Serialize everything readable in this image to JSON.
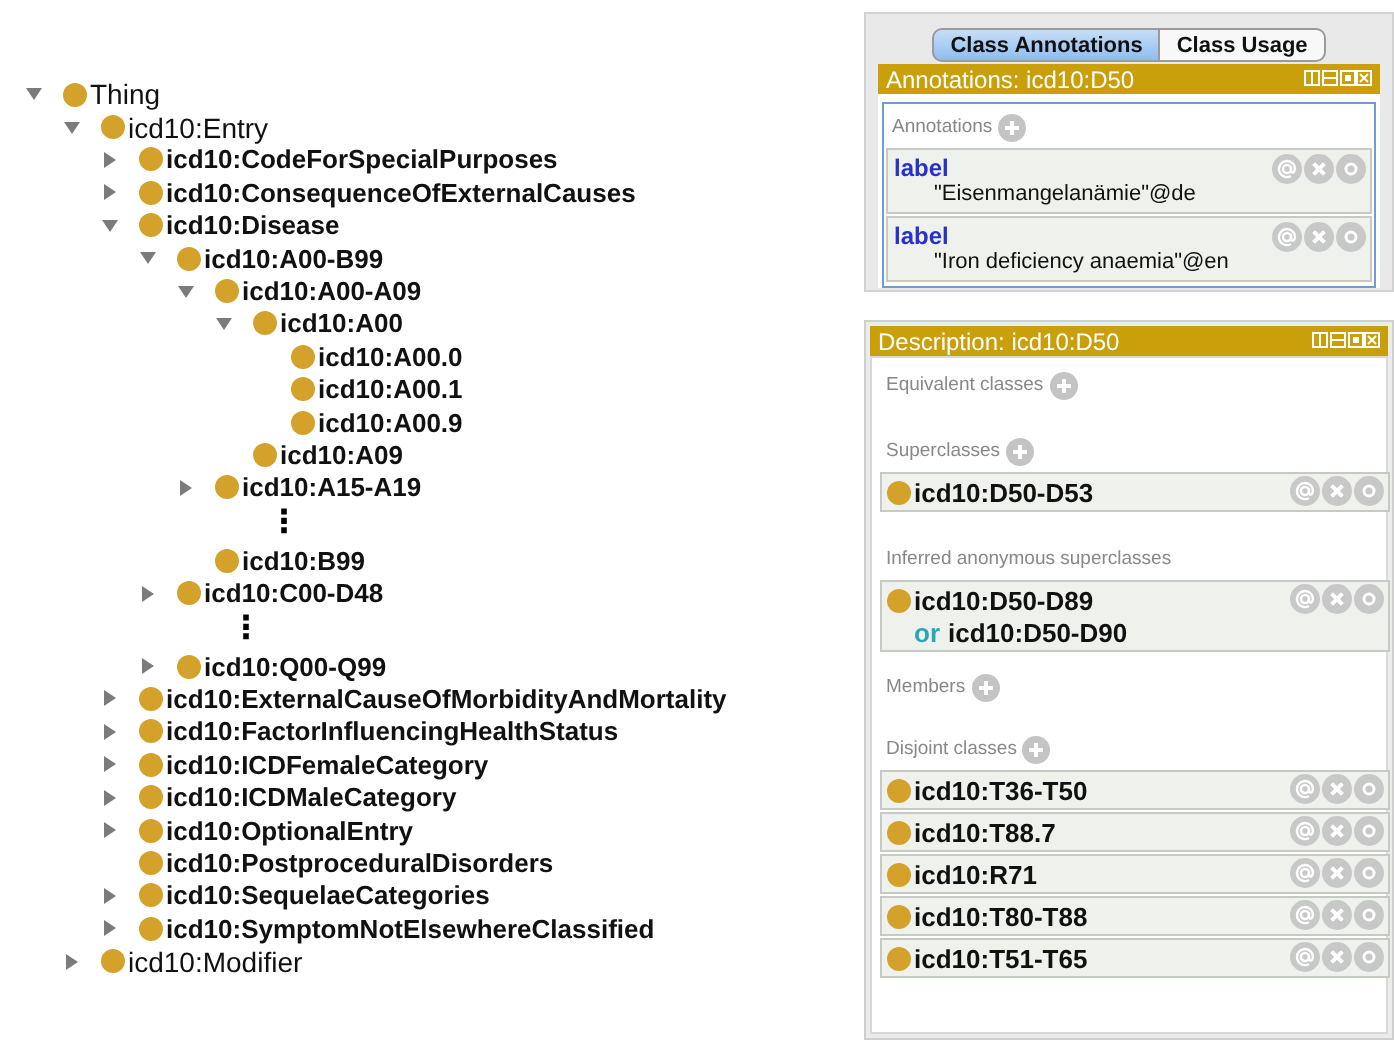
{
  "class_tree": [
    {
      "label": "Thing",
      "bold": false,
      "expanded": true,
      "children": [
        {
          "label": "icd10:Entry",
          "bold": false,
          "expanded": true,
          "children": [
            {
              "label": "icd10:CodeForSpecialPurposes",
              "bold": true,
              "expanded": false
            },
            {
              "label": "icd10:ConsequenceOfExternalCauses",
              "bold": true,
              "expanded": false
            },
            {
              "label": "icd10:Disease",
              "bold": true,
              "expanded": true,
              "children": [
                {
                  "label": "icd10:A00-B99",
                  "bold": true,
                  "expanded": true,
                  "children": [
                    {
                      "label": "icd10:A00-A09",
                      "bold": true,
                      "expanded": true,
                      "children": [
                        {
                          "label": "icd10:A00",
                          "bold": true,
                          "expanded": true,
                          "children": [
                            {
                              "label": "icd10:A00.0",
                              "bold": true
                            },
                            {
                              "label": "icd10:A00.1",
                              "bold": true
                            },
                            {
                              "label": "icd10:A00.9",
                              "bold": true
                            }
                          ]
                        },
                        {
                          "label": "icd10:A09",
                          "bold": true
                        }
                      ]
                    },
                    {
                      "label": "icd10:A15-A19",
                      "bold": true,
                      "expanded": false
                    },
                    {
                      "kind": "ellipsis",
                      "label": "⋮"
                    },
                    {
                      "label": "icd10:B99",
                      "bold": true
                    }
                  ]
                },
                {
                  "label": "icd10:C00-D48",
                  "bold": true,
                  "expanded": false
                },
                {
                  "kind": "ellipsis",
                  "label": "⋮"
                },
                {
                  "label": "icd10:Q00-Q99",
                  "bold": true,
                  "expanded": false
                }
              ]
            },
            {
              "label": "icd10:ExternalCauseOfMorbidityAndMortality",
              "bold": true,
              "expanded": false
            },
            {
              "label": "icd10:FactorInfluencingHealthStatus",
              "bold": true,
              "expanded": false
            },
            {
              "label": "icd10:ICDFemaleCategory",
              "bold": true,
              "expanded": false
            },
            {
              "label": "icd10:ICDMaleCategory",
              "bold": true,
              "expanded": false
            },
            {
              "label": "icd10:OptionalEntry",
              "bold": true,
              "expanded": false
            },
            {
              "label": "icd10:PostproceduralDisorders",
              "bold": true
            },
            {
              "label": "icd10:SequelaeCategories",
              "bold": true,
              "expanded": false
            },
            {
              "label": "icd10:SymptomNotElsewhereClassified",
              "bold": true,
              "expanded": false
            }
          ]
        },
        {
          "label": "icd10:Modifier",
          "bold": false,
          "expanded": false
        }
      ]
    }
  ],
  "annotations_view": {
    "tabs": [
      {
        "label": "Class Annotations",
        "selected": true
      },
      {
        "label": "Class Usage",
        "selected": false
      }
    ],
    "title": "Annotations: icd10:D50",
    "section": "Annotations",
    "items": [
      {
        "property": "label",
        "value": "\"Eisenmangelanämie\"@de"
      },
      {
        "property": "label",
        "value": "\"Iron deficiency anaemia\"@en"
      }
    ]
  },
  "description_view": {
    "title": "Description: icd10:D50",
    "sections": [
      {
        "heading": "Equivalent classes",
        "addable": true
      },
      {
        "heading": "Superclasses",
        "addable": true,
        "items": [
          {
            "class": "icd10:D50-D53"
          }
        ]
      },
      {
        "heading": "Inferred anonymous superclasses",
        "addable": false,
        "items": [
          {
            "class": "icd10:D50-D89",
            "operator": "or",
            "operand": "icd10:D50-D90"
          }
        ]
      },
      {
        "heading": "Members",
        "addable": true
      },
      {
        "heading": "Disjoint classes",
        "addable": true,
        "items": [
          {
            "class": "icd10:T36-T50"
          },
          {
            "class": "icd10:T88.7"
          },
          {
            "class": "icd10:R71"
          },
          {
            "class": "icd10:T80-T88"
          },
          {
            "class": "icd10:T51-T65"
          }
        ]
      }
    ]
  }
}
